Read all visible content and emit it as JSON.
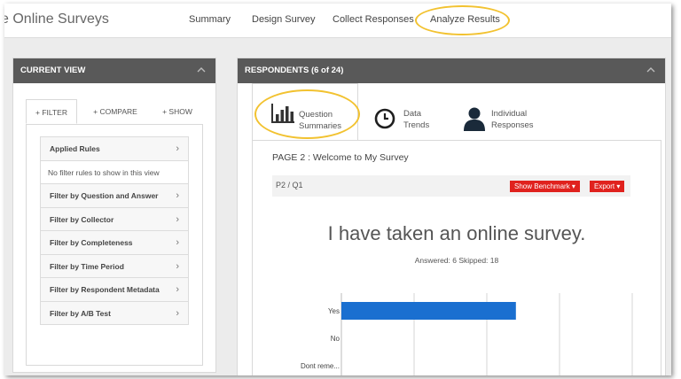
{
  "nav": {
    "app_title": "e Online Surveys",
    "items": [
      "Summary",
      "Design Survey",
      "Collect Responses",
      "Analyze Results"
    ]
  },
  "left_panel": {
    "header": "CURRENT VIEW",
    "tabs": [
      "+ FILTER",
      "+ COMPARE",
      "+ SHOW"
    ],
    "applied_rules": "Applied Rules",
    "no_rules": "No filter rules to show in this view",
    "filters": [
      "Filter by Question and Answer",
      "Filter by Collector",
      "Filter by Completeness",
      "Filter by Time Period",
      "Filter by Respondent Metadata",
      "Filter by A/B Test"
    ]
  },
  "right_panel": {
    "header": "RESPONDENTS (6 of 24)",
    "view_tabs": [
      {
        "line1": "Question",
        "line2": "Summaries",
        "icon": "bar-chart-icon"
      },
      {
        "line1": "Data",
        "line2": "Trends",
        "icon": "clock-icon"
      },
      {
        "line1": "Individual",
        "line2": "Responses",
        "icon": "person-icon"
      }
    ],
    "page_title": "PAGE 2 : Welcome to My Survey",
    "question_id": "P2 / Q1",
    "show_benchmark": "Show Benchmark ▾",
    "export": "Export ▾",
    "question_text": "I have taken an online survey.",
    "answered_text": "Answered: 6  Skipped: 18"
  },
  "chart_data": {
    "type": "bar",
    "orientation": "horizontal",
    "categories": [
      "Yes",
      "No",
      "Dont reme..."
    ],
    "values": [
      60,
      0,
      0
    ],
    "xlim": [
      0,
      100
    ],
    "grid": true,
    "color": "#1a6fd0"
  },
  "colors": {
    "header_bg": "#595959",
    "accent_red": "#e0221e",
    "highlight_yellow": "#f2c230",
    "bar_blue": "#1a6fd0"
  }
}
